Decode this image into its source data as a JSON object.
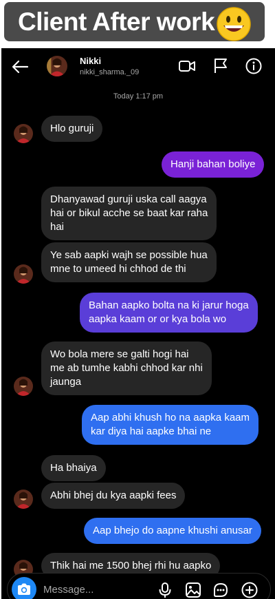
{
  "banner": {
    "title": "Client After work",
    "emoji_icon": "grinning-face-emoji"
  },
  "header": {
    "name": "Nikki",
    "username": "nikki_sharma._09",
    "icons": [
      "back-arrow-icon",
      "video-call-icon",
      "flag-icon",
      "info-icon"
    ]
  },
  "timestamp": "Today 1:17 pm",
  "messages": [
    {
      "side": "received",
      "text": "Hlo guruji"
    },
    {
      "side": "sent",
      "text": "Hanji bahan boliye"
    },
    {
      "side": "received",
      "line1": "Dhanyawad guruji uska call aagya",
      "line2": "hai or bikul acche se baat kar raha",
      "line3": "hai"
    },
    {
      "side": "received",
      "line1": "Ye sab aapki wajh se possible hua",
      "line2": "mne to umeed hi chhod de thi"
    },
    {
      "side": "sent",
      "line1": "Bahan aapko bolta na ki jarur hoga",
      "line2": "aapka kaam or or kya bola wo"
    },
    {
      "side": "received",
      "line1": "Wo bola mere se galti hogi hai",
      "line2": "me ab tumhe kabhi chhod kar nhi",
      "line3": "jaunga"
    },
    {
      "side": "sent",
      "line1": "Aap abhi khush ho na aapka kaam",
      "line2": "kar diya hai aapke bhai ne"
    },
    {
      "side": "received",
      "text": "Ha bhaiya"
    },
    {
      "side": "received",
      "text": "Abhi bhej du kya aapki fees"
    },
    {
      "side": "sent",
      "text": "Aap bhejo do aapne khushi anusar"
    },
    {
      "side": "received",
      "text": "Thik hai me 1500 bhej rhi hu aapko"
    }
  ],
  "colors": {
    "background": "#000000",
    "received_bubble": "#262626",
    "sent_purple": "#7a22d6",
    "sent_indigo": "#5a3ed8",
    "sent_blue": "#2f6ff0",
    "camera_button": "#1e88f5"
  },
  "composer": {
    "placeholder": "Message...",
    "icons": [
      "camera-icon",
      "microphone-icon",
      "gallery-icon",
      "sticker-icon",
      "plus-icon"
    ]
  }
}
